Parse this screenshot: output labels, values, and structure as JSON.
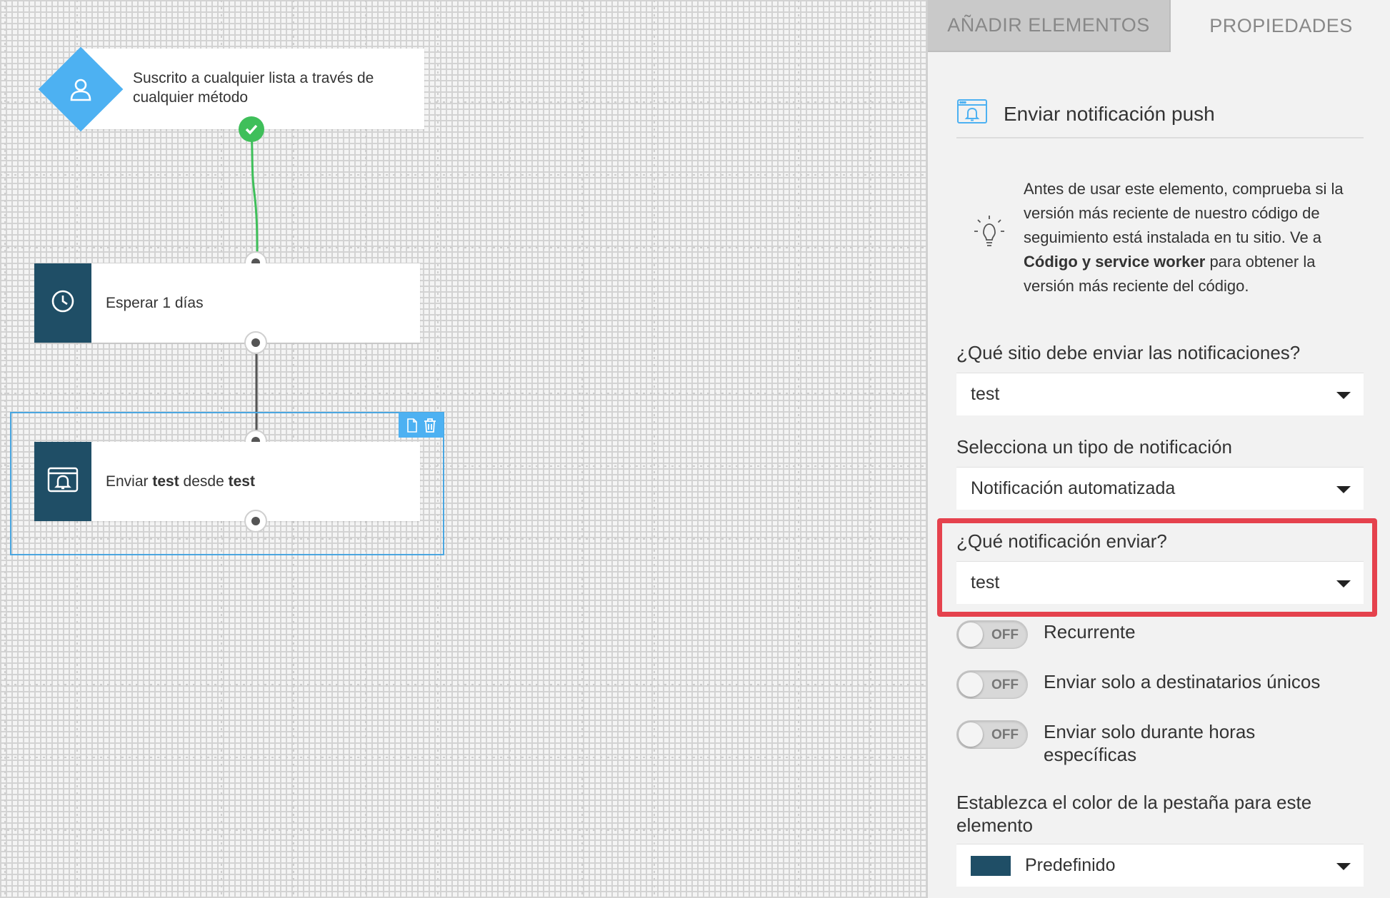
{
  "canvas": {
    "trigger": {
      "text": "Suscrito a cualquier lista a través de cualquier método"
    },
    "wait_node": {
      "text": "Esperar 1 días"
    },
    "push_node": {
      "prefix": "Enviar ",
      "bold1": "test",
      "middle": " desde ",
      "bold2": "test"
    },
    "toolbar": {
      "duplicate_icon": "copy-icon",
      "delete_icon": "trash-icon"
    }
  },
  "panel": {
    "tabs": [
      {
        "label": "AÑADIR ELEMENTOS",
        "active": false
      },
      {
        "label": "PROPIEDADES",
        "active": true
      }
    ],
    "header": {
      "title": "Enviar notificación push",
      "icon": "push-notification-icon"
    },
    "tip": {
      "before": "Antes de usar este elemento, comprueba si la versión más reciente de nuestro código de seguimiento está instalada en tu sitio. Ve a ",
      "bold": "Código y service worker",
      "after": " para obtener la versión más reciente del código.",
      "icon": "lightbulb-icon"
    },
    "site_field": {
      "label": "¿Qué sitio debe enviar las notificaciones?",
      "value": "test"
    },
    "type_field": {
      "label": "Selecciona un tipo de notificación",
      "value": "Notificación automatizada"
    },
    "notification_field": {
      "label": "¿Qué notificación enviar?",
      "value": "test"
    },
    "toggles": [
      {
        "state": "OFF",
        "label": "Recurrente"
      },
      {
        "state": "OFF",
        "label": "Enviar solo a destinatarios únicos"
      },
      {
        "state": "OFF",
        "label": "Enviar solo durante horas específicas"
      }
    ],
    "color_field": {
      "label": "Establezca el color de la pestaña para este elemento",
      "value": "Predefinido",
      "swatch_color": "#1f4e66"
    }
  },
  "colors": {
    "accent": "#4db1f2",
    "node_dark": "#1f4e66",
    "success": "#3fbf5a",
    "highlight": "#e5424d"
  }
}
